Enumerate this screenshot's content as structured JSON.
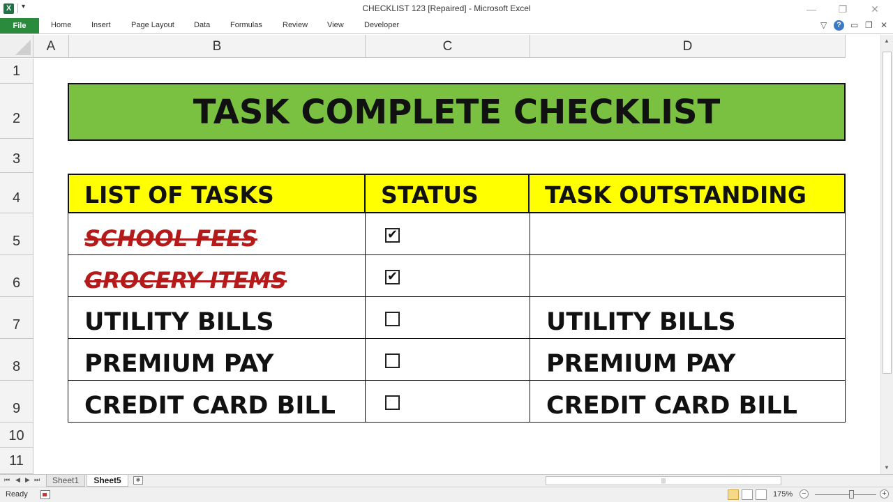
{
  "window": {
    "title": "CHECKLIST 123 [Repaired]  -  Microsoft Excel",
    "logo_letter": "X",
    "qat_arrow": "▾",
    "minimize": "—",
    "restore": "❐",
    "close": "✕"
  },
  "ribbon": {
    "file_label": "File",
    "tabs": [
      "Home",
      "Insert",
      "Page Layout",
      "Data",
      "Formulas",
      "Review",
      "View",
      "Developer"
    ],
    "right_icons": [
      "chevron-down-icon",
      "help-icon",
      "minimize-window-icon",
      "restore-window-icon",
      "close-window-icon"
    ],
    "help_glyph": "?"
  },
  "grid": {
    "columns": [
      "A",
      "B",
      "C",
      "D"
    ],
    "rows": [
      "1",
      "2",
      "3",
      "4",
      "5",
      "6",
      "7",
      "8",
      "9",
      "10",
      "11"
    ]
  },
  "sheet": {
    "banner_title": "TASK COMPLETE CHECKLIST",
    "banner_color": "#7ac142",
    "header_color": "#ffff00",
    "completed_color": "#b51a1a",
    "headers": [
      "LIST OF TASKS",
      "STATUS",
      "TASK OUTSTANDING"
    ],
    "tasks": [
      {
        "task": "SCHOOL FEES",
        "checked": true,
        "outstanding": ""
      },
      {
        "task": "GROCERY ITEMS ",
        "checked": true,
        "outstanding": ""
      },
      {
        "task": "UTILITY BILLS",
        "checked": false,
        "outstanding": "UTILITY BILLS"
      },
      {
        "task": "PREMIUM PAY",
        "checked": false,
        "outstanding": "PREMIUM PAY"
      },
      {
        "task": "CREDIT CARD BILL",
        "checked": false,
        "outstanding": "CREDIT CARD BILL"
      }
    ],
    "check_glyph": "✔"
  },
  "sheet_tabs": {
    "tabs": [
      "Sheet1",
      "Sheet5"
    ],
    "active": "Sheet5",
    "new_sheet_glyph": "✱"
  },
  "status_bar": {
    "status": "Ready",
    "zoom": "175%",
    "zoom_level_percent": 175,
    "zoom_minus": "−",
    "zoom_plus": "+"
  }
}
